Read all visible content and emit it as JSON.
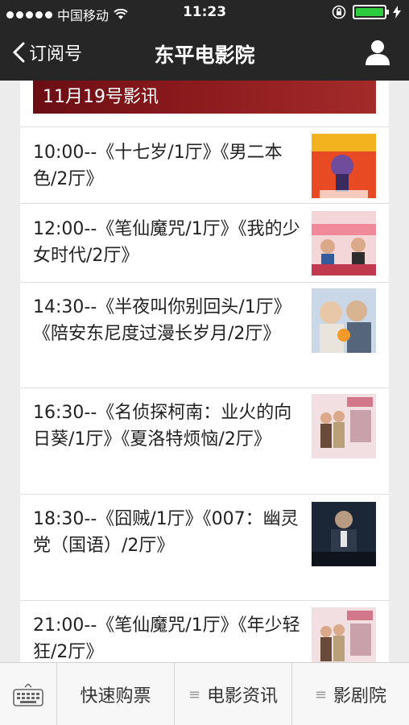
{
  "status": {
    "carrier": "中国移动",
    "time": "11:23"
  },
  "nav": {
    "back_label": "订阅号",
    "title": "东平电影院"
  },
  "banner": {
    "title": "11月19号影讯"
  },
  "schedule": [
    {
      "text": "10:00--《十七岁/1厅》《男二本色/2厅》"
    },
    {
      "text": "12:00--《笔仙魔咒/1厅》《我的少女时代/2厅》"
    },
    {
      "text": "14:30--《半夜叫你别回头/1厅》《陪安东尼度过漫长岁月/2厅》"
    },
    {
      "text": "16:30--《名侦探柯南：业火的向日葵/1厅》《夏洛特烦恼/2厅》"
    },
    {
      "text": "18:30--《囧贼/1厅》《007：幽灵党（国语）/2厅》"
    },
    {
      "text": "21:00--《笔仙魔咒/1厅》《年少轻狂/2厅》"
    }
  ],
  "tabbar": {
    "items": [
      "快速购票",
      "电影资讯",
      "影剧院"
    ]
  }
}
